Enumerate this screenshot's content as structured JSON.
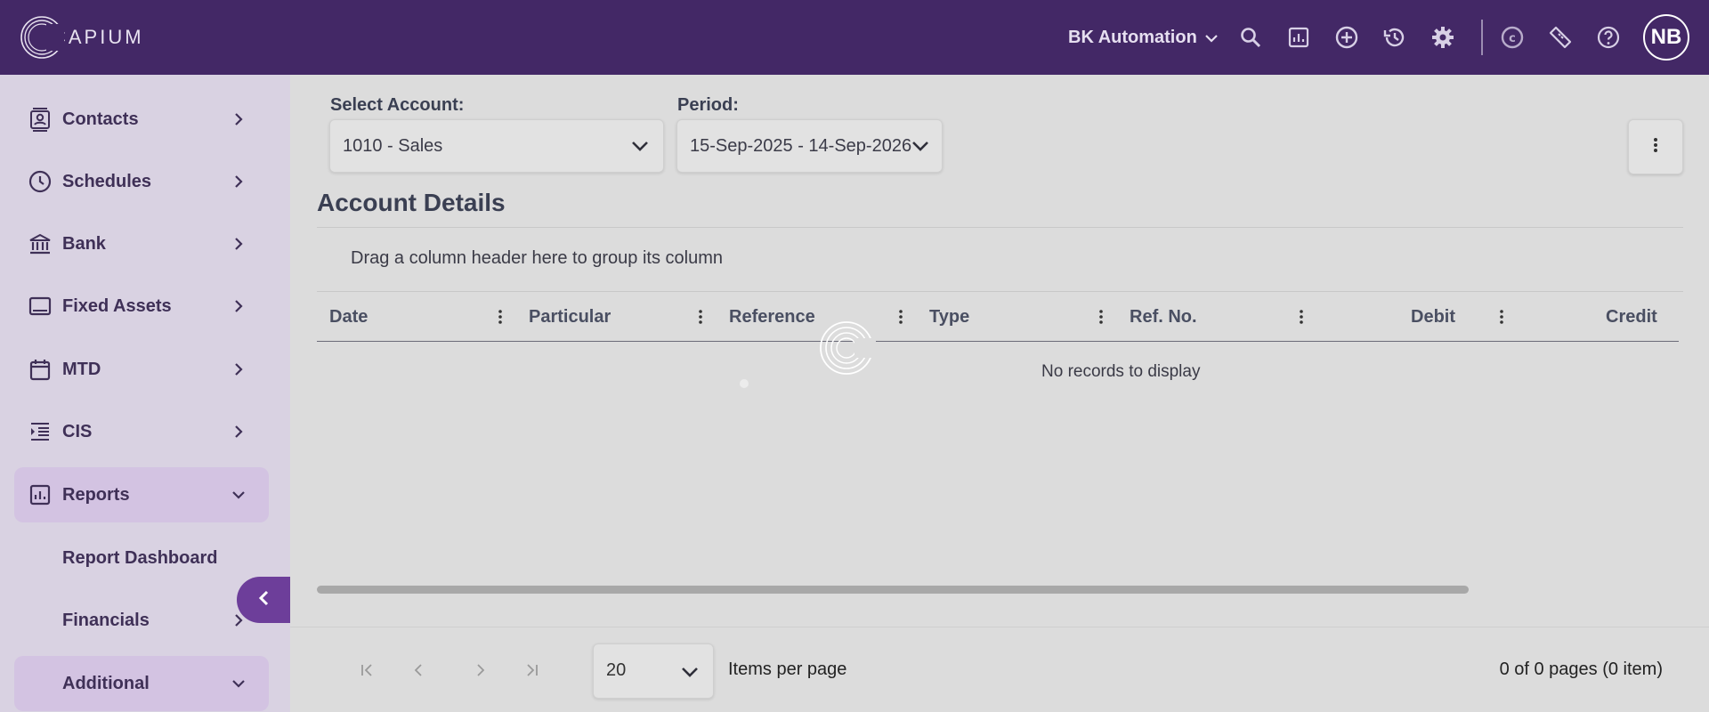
{
  "app": {
    "logo_text": "CAPIUM",
    "organization": "BK Automation",
    "user_initials": "NB"
  },
  "topbar_icons": [
    "search-icon",
    "report-icon",
    "add-circle-icon",
    "history-icon",
    "settings-icon",
    "capium-c-icon",
    "ticket-icon",
    "help-icon"
  ],
  "sidebar": {
    "items": [
      {
        "label": "Contacts",
        "icon": "contacts-icon"
      },
      {
        "label": "Schedules",
        "icon": "clock-icon"
      },
      {
        "label": "Bank",
        "icon": "bank-icon"
      },
      {
        "label": "Fixed Assets",
        "icon": "monitor-icon"
      },
      {
        "label": "MTD",
        "icon": "calendar-icon"
      },
      {
        "label": "CIS",
        "icon": "indent-list-icon"
      },
      {
        "label": "Reports",
        "icon": "report-icon"
      }
    ],
    "sub_items": [
      {
        "label": "Report Dashboard"
      },
      {
        "label": "Financials"
      },
      {
        "label": "Additional"
      }
    ]
  },
  "filters": {
    "account_label": "Select Account:",
    "account_value": "1010 - Sales",
    "period_label": "Period:",
    "period_value": "15-Sep-2025 - 14-Sep-2026"
  },
  "main": {
    "title": "Account Details",
    "group_hint": "Drag a column header here to group its column",
    "columns": [
      "Date",
      "Particular",
      "Reference",
      "Type",
      "Ref. No.",
      "Debit",
      "Credit"
    ],
    "empty_text": "No records to display"
  },
  "pager": {
    "page_size": "20",
    "items_per_page_label": "Items per page",
    "info": "0 of 0 pages (0 item)"
  },
  "colors": {
    "topbar": "#432866",
    "sidebar": "#d9d2e2",
    "accent": "#6d3e9a"
  }
}
